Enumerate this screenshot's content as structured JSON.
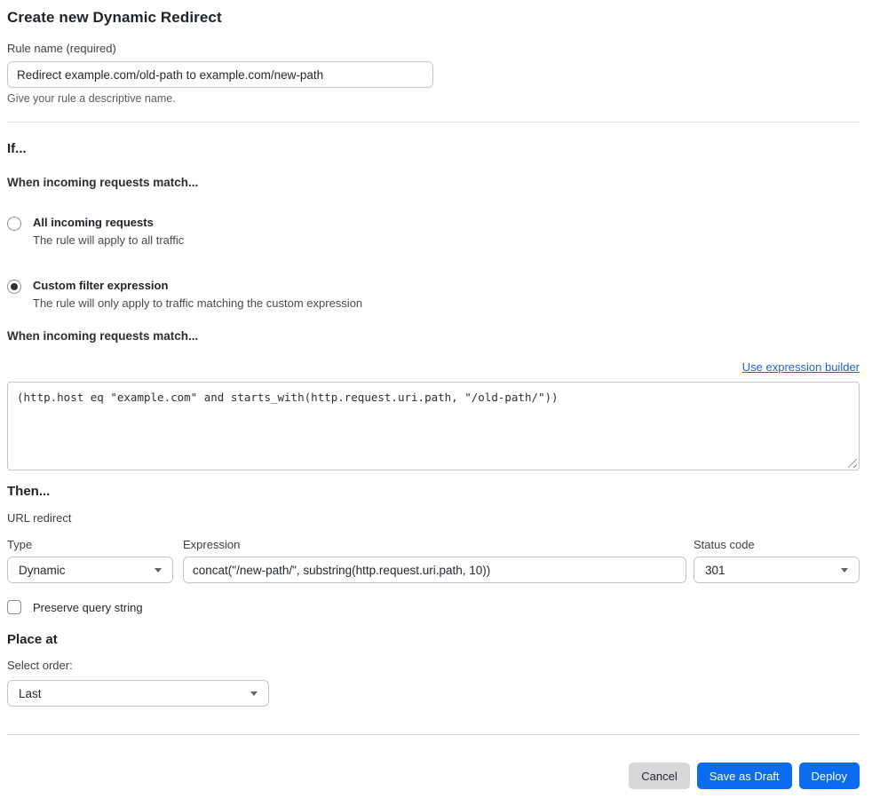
{
  "page": {
    "title": "Create new Dynamic Redirect"
  },
  "rule_name": {
    "label": "Rule name (required)",
    "value": "Redirect example.com/old-path to example.com/new-path",
    "helper": "Give your rule a descriptive name."
  },
  "if_section": {
    "heading": "If...",
    "match_heading": "When incoming requests match...",
    "options": [
      {
        "label": "All incoming requests",
        "description": "The rule will apply to all traffic",
        "selected": false
      },
      {
        "label": "Custom filter expression",
        "description": "The rule will only apply to traffic matching the custom expression",
        "selected": true
      }
    ],
    "expression_heading": "When incoming requests match...",
    "builder_link": "Use expression builder",
    "expression_value": "(http.host eq \"example.com\" and starts_with(http.request.uri.path, \"/old-path/\"))"
  },
  "then_section": {
    "heading": "Then...",
    "subtitle": "URL redirect",
    "type": {
      "label": "Type",
      "value": "Dynamic"
    },
    "expression": {
      "label": "Expression",
      "value": "concat(\"/new-path/\", substring(http.request.uri.path, 10))"
    },
    "status_code": {
      "label": "Status code",
      "value": "301"
    },
    "preserve_query_label": "Preserve query string",
    "preserve_query_checked": false
  },
  "place_at": {
    "heading": "Place at",
    "order_label": "Select order:",
    "order_value": "Last"
  },
  "footer": {
    "cancel": "Cancel",
    "save_draft": "Save as Draft",
    "deploy": "Deploy"
  },
  "colors": {
    "primary_blue": "#0b6cf0",
    "link_blue": "#1d62d6",
    "cancel_gray": "#d7d7d9"
  }
}
